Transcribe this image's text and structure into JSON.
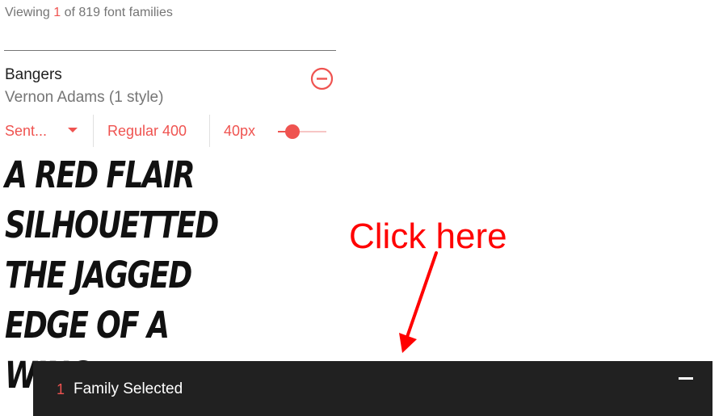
{
  "header": {
    "viewing_prefix": "Viewing",
    "viewing_count": "1",
    "viewing_suffix": "of 819 font families"
  },
  "font_card": {
    "family_name": "Bangers",
    "designer": "Vernon Adams (1 style)",
    "remove_icon": "minus-circle-icon",
    "sample_selector": "Sent...",
    "weight": "Regular 400",
    "size": "40px",
    "size_slider_fraction": 0.3,
    "sample_text": "A red flair silhouetted the jagged edge of a wing."
  },
  "annotation": {
    "text": "Click here",
    "color": "#ff0000"
  },
  "footer": {
    "count": "1",
    "label": "Family Selected",
    "collapse_icon": "minus-icon"
  },
  "colors": {
    "accent": "#ef5350",
    "footer_bg": "#212121"
  }
}
